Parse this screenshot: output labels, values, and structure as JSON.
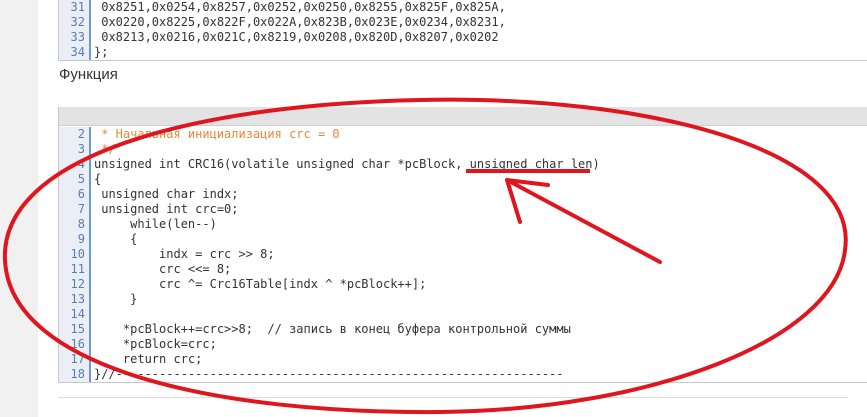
{
  "top_code": {
    "lines": [
      {
        "num": "31",
        "text": " 0x8251,0x0254,0x8257,0x0252,0x0250,0x8255,0x825F,0x825A,"
      },
      {
        "num": "32",
        "text": " 0x0220,0x8225,0x822F,0x022A,0x823B,0x023E,0x0234,0x8231,"
      },
      {
        "num": "33",
        "text": " 0x8213,0x0216,0x021C,0x8219,0x0208,0x820D,0x8207,0x0202"
      },
      {
        "num": "34",
        "text": "};"
      }
    ]
  },
  "section": {
    "title": "Функция"
  },
  "code": {
    "lines": [
      {
        "num": "2",
        "text": " * Начальная инициализация crc = 0"
      },
      {
        "num": "3",
        "text": " */"
      },
      {
        "num": "4",
        "text": "unsigned int CRC16(volatile unsigned char *pcBlock, unsigned char len)"
      },
      {
        "num": "5",
        "text": "{"
      },
      {
        "num": "6",
        "text": " unsigned char indx;"
      },
      {
        "num": "7",
        "text": " unsigned int crc=0;"
      },
      {
        "num": "8",
        "text": "     while(len--)"
      },
      {
        "num": "9",
        "text": "     {"
      },
      {
        "num": "10",
        "text": "         indx = crc >> 8;"
      },
      {
        "num": "11",
        "text": "         crc <<= 8;"
      },
      {
        "num": "12",
        "text": "         crc ^= Crc16Table[indx ^ *pcBlock++];"
      },
      {
        "num": "13",
        "text": "     }"
      },
      {
        "num": "14",
        "text": ""
      },
      {
        "num": "15",
        "text": "    *pcBlock++=crc>>8;  // запись в конец буфера контрольной суммы"
      },
      {
        "num": "16",
        "text": "    *pcBlock=crc;"
      },
      {
        "num": "17",
        "text": "    return crc;"
      },
      {
        "num": "18",
        "text": "}//--------------------------------------------------------------"
      }
    ]
  },
  "colors": {
    "annotation": "#e0161e",
    "gutter_border": "#6b9ad6",
    "comment": "#e8873a"
  }
}
